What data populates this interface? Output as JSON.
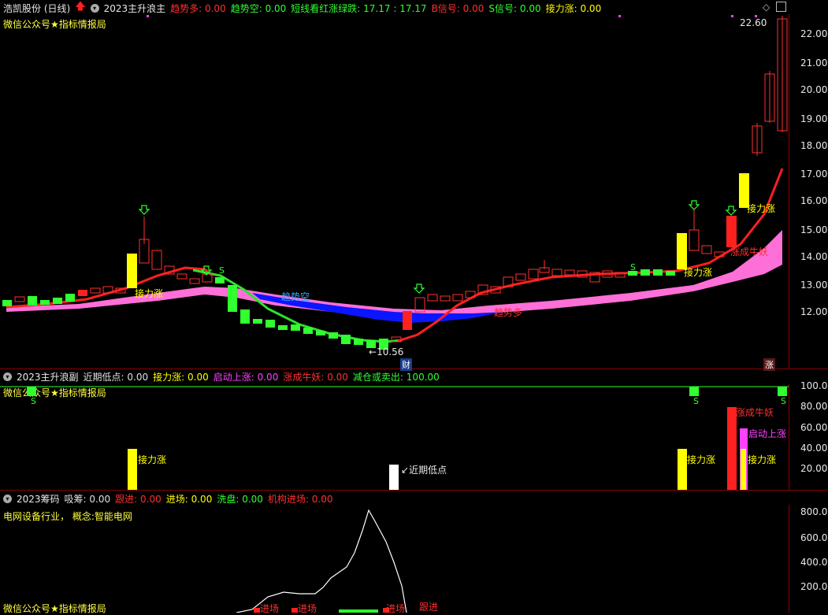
{
  "main": {
    "stock_name": "浩凯股份 (日线)",
    "indicator_name": "2023主升浪主",
    "values": [
      {
        "label": "趋势多:",
        "value": "0.00",
        "color": "#ff3030"
      },
      {
        "label": "趋势空:",
        "value": "0.00",
        "color": "#30ff30"
      },
      {
        "label": "短线看红涨绿跌:",
        "value": "17.17 : 17.17",
        "color": "#30ff30"
      },
      {
        "label": "B信号:",
        "value": "0.00",
        "color": "#ff3030"
      },
      {
        "label": "S信号:",
        "value": "0.00",
        "color": "#30ff30"
      },
      {
        "label": "接力涨:",
        "value": "0.00",
        "color": "#ffff00"
      }
    ],
    "watermark": "微信公众号★指标情报局",
    "y_labels": [
      "22.00",
      "21.00",
      "20.00",
      "19.00",
      "18.00",
      "17.00",
      "16.00",
      "15.00",
      "14.00",
      "13.00",
      "12.00"
    ],
    "high_label": "22.60",
    "low_label": "10.56",
    "annotations": {
      "trend_short": "趋势空",
      "trend_long": "趋势多",
      "relay_up": "接力涨",
      "monster": "涨成牛妖",
      "s_signal": "S",
      "cai": "财",
      "zhang": "涨"
    }
  },
  "sub1": {
    "indicator_name": "2023主升浪副",
    "values": [
      {
        "label": "近期低点:",
        "value": "0.00",
        "color": "#e0e0e0"
      },
      {
        "label": "接力涨:",
        "value": "0.00",
        "color": "#ffff00"
      },
      {
        "label": "启动上涨:",
        "value": "0.00",
        "color": "#ff40ff"
      },
      {
        "label": "涨成牛妖:",
        "value": "0.00",
        "color": "#ff3030"
      },
      {
        "label": "减仓或卖出:",
        "value": "100.00",
        "color": "#30ff30"
      }
    ],
    "watermark": "微信公众号★指标情报局",
    "y_labels": [
      "100.0",
      "80.00",
      "60.00",
      "40.00",
      "20.00"
    ],
    "annotations": {
      "relay_up": "接力涨",
      "recent_low": "近期低点",
      "monster": "涨成牛妖",
      "start_up": "启动上涨",
      "s_signal": "S"
    }
  },
  "sub2": {
    "indicator_name": "2023筹码",
    "values": [
      {
        "label": "吸筹:",
        "value": "0.00",
        "color": "#e0e0e0"
      },
      {
        "label": "跟进:",
        "value": "0.00",
        "color": "#ff3030"
      },
      {
        "label": "进场:",
        "value": "0.00",
        "color": "#ffff00"
      },
      {
        "label": "洗盘:",
        "value": "0.00",
        "color": "#30ff30"
      },
      {
        "label": "机构进场:",
        "value": "0.00",
        "color": "#ff3030"
      }
    ],
    "industry_line": "电网设备行业，  概念:智能电网",
    "watermark": "微信公众号★指标情报局",
    "y_labels": [
      "800.0",
      "600.0",
      "400.0",
      "200.0"
    ],
    "annotations": {
      "enter": "进场",
      "follow": "跟进"
    }
  }
}
